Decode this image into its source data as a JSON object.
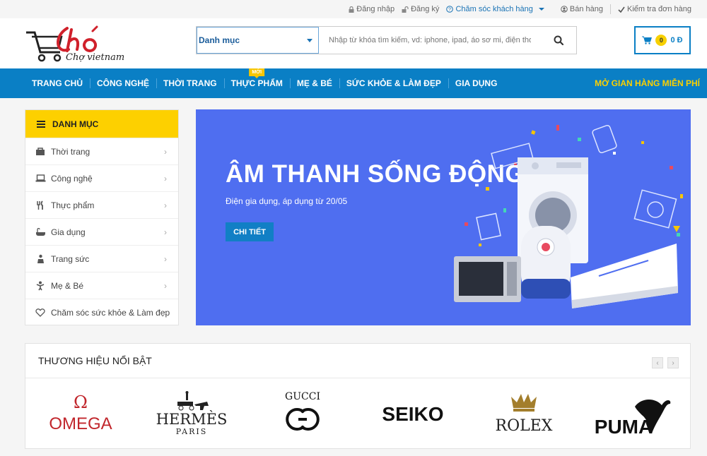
{
  "topbar": {
    "login": "Đăng nhập",
    "register": "Đăng ký",
    "support": "Chăm sóc khách hàng",
    "sell": "Bán hàng",
    "track": "Kiểm tra đơn hàng"
  },
  "header": {
    "logo_text": "Chợ vietnam",
    "category_label": "Danh mục",
    "search_placeholder": "Nhập từ khóa tìm kiếm, vd: iphone, ipad, áo sơ mi, điện thoại...",
    "cart_count": "0",
    "cart_total": "0 Đ"
  },
  "nav": {
    "items": [
      "TRANG CHỦ",
      "CÔNG NGHỆ",
      "THỜI TRANG",
      "THỰC PHẨM",
      "MẸ & BÉ",
      "SỨC KHỎE & LÀM ĐẸP",
      "GIA DỤNG"
    ],
    "new_badge": "MỚI",
    "free_store": "MỞ GIAN HÀNG MIỄN PHÍ"
  },
  "sidebar": {
    "title": "DANH MỤC",
    "items": [
      {
        "label": "Thời trang",
        "icon": "bag-icon"
      },
      {
        "label": "Công nghệ",
        "icon": "laptop-icon"
      },
      {
        "label": "Thực phẩm",
        "icon": "cutlery-icon"
      },
      {
        "label": "Gia dụng",
        "icon": "bathtub-icon"
      },
      {
        "label": "Trang sức",
        "icon": "jewelry-icon"
      },
      {
        "label": "Mẹ & Bé",
        "icon": "child-icon"
      },
      {
        "label": "Chăm sóc sức khỏe & Làm đẹp",
        "icon": "heart-icon"
      }
    ]
  },
  "banner": {
    "title": "ÂM THANH SỐNG ĐỘNG",
    "subtitle": "Điện gia dụng, áp dụng từ 20/05",
    "cta": "CHI TIẾT"
  },
  "brands": {
    "title": "THƯƠNG HIỆU NỔI BẬT",
    "prev": "‹",
    "next": "›",
    "omega": "OMEGA",
    "hermes": "HERMÈS",
    "hermes_sub": "PARIS",
    "gucci": "GUCCI",
    "seiko": "SEIKO",
    "rolex": "ROLEX",
    "puma": "PUMA"
  },
  "colors": {
    "primary": "#0a7fc5",
    "accent": "#fdd000",
    "banner": "#4f6ef0"
  }
}
